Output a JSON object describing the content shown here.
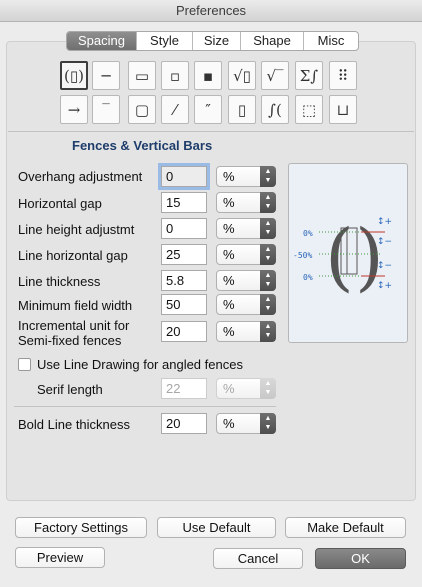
{
  "window": {
    "title": "Preferences"
  },
  "tabs": [
    {
      "label": "Spacing",
      "active": true
    },
    {
      "label": "Style",
      "active": false
    },
    {
      "label": "Size",
      "active": false
    },
    {
      "label": "Shape",
      "active": false
    },
    {
      "label": "Misc",
      "active": false
    }
  ],
  "toolbar": {
    "row1": [
      {
        "icon": "fence-parentheses-icon",
        "glyph": "(▯)",
        "active": true
      },
      {
        "icon": "fraction-icon",
        "glyph": "─"
      },
      {
        "icon": "stacked-box-icon",
        "glyph": "▭"
      },
      {
        "icon": "subscript-superscript-icon",
        "glyph": "▫"
      },
      {
        "icon": "script-box-icon",
        "glyph": "▪"
      },
      {
        "icon": "square-root-icon",
        "glyph": "√▯"
      },
      {
        "icon": "radical-icon",
        "glyph": "√‾"
      },
      {
        "icon": "sum-integral-icon",
        "glyph": "Σ∫"
      },
      {
        "icon": "matrix-icon",
        "glyph": "⠿"
      }
    ],
    "row2": [
      {
        "icon": "arrow-over-icon",
        "glyph": "→"
      },
      {
        "icon": "overbar-icon",
        "glyph": "‾"
      },
      {
        "icon": "box-frame-icon",
        "glyph": "▢"
      },
      {
        "icon": "strikeout-icon",
        "glyph": "⁄"
      },
      {
        "icon": "prime-icon",
        "glyph": "″"
      },
      {
        "icon": "tall-box-icon",
        "glyph": "▯"
      },
      {
        "icon": "integral-icon",
        "glyph": "∫("
      },
      {
        "icon": "dotted-box-icon",
        "glyph": "⬚"
      },
      {
        "icon": "bracket-icon",
        "glyph": "⊔"
      }
    ]
  },
  "section": {
    "title": "Fences & Vertical Bars"
  },
  "fields": [
    {
      "label": "Overhang adjustment",
      "value": "0",
      "unit": "%"
    },
    {
      "label": "Horizontal gap",
      "value": "15",
      "unit": "%"
    },
    {
      "label": "Line height adjustmt",
      "value": "0",
      "unit": "%"
    },
    {
      "label": "Line horizontal gap",
      "value": "25",
      "unit": "%"
    },
    {
      "label": "Line thickness",
      "value": "5.8",
      "unit": "%"
    },
    {
      "label": "Minimum field width",
      "value": "50",
      "unit": "%"
    },
    {
      "label": "Incremental unit for",
      "label2": "Semi-fixed fences",
      "value": "20",
      "unit": "%"
    }
  ],
  "line_drawing": {
    "label": "Use Line Drawing for angled fences",
    "checked": false
  },
  "serif": {
    "label": "Serif length",
    "value": "22",
    "unit": "%"
  },
  "bold": {
    "label": "Bold Line thickness",
    "value": "20",
    "unit": "%"
  },
  "preview_labels": {
    "top": "0%",
    "mid": "-50%",
    "bottom": "0%"
  },
  "buttons": {
    "factory": "Factory Settings",
    "use_default": "Use Default",
    "make_default": "Make Default",
    "preview": "Preview",
    "cancel": "Cancel",
    "ok": "OK"
  },
  "colors": {
    "accent": "#1f3d6b",
    "preview_blue": "#2a66b8",
    "preview_red": "#c0392b",
    "preview_green": "#3c9a3c"
  }
}
